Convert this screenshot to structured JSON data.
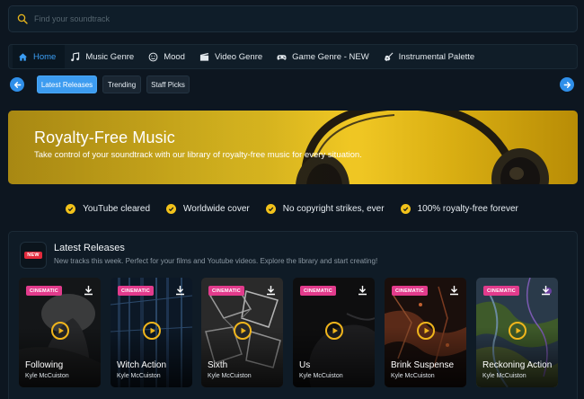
{
  "search": {
    "placeholder": "Find your soundtrack",
    "value": ""
  },
  "nav": {
    "tabs": [
      {
        "label": "Home",
        "icon": "home-icon",
        "active": true
      },
      {
        "label": "Music Genre",
        "icon": "music-note-icon",
        "active": false
      },
      {
        "label": "Mood",
        "icon": "smiley-icon",
        "active": false
      },
      {
        "label": "Video Genre",
        "icon": "film-icon",
        "active": false
      },
      {
        "label": "Game Genre - NEW",
        "icon": "gamepad-icon",
        "active": false
      },
      {
        "label": "Instrumental Palette",
        "icon": "guitar-icon",
        "active": false
      }
    ]
  },
  "subnav": {
    "pills": [
      {
        "label": "Latest Releases",
        "active": true
      },
      {
        "label": "Trending",
        "active": false
      },
      {
        "label": "Staff Picks",
        "active": false
      }
    ]
  },
  "hero": {
    "title": "Royalty-Free Music",
    "subtitle": "Take control of your soundtrack with our library of royalty-free music for every situation."
  },
  "features": [
    "YouTube cleared",
    "Worldwide cover",
    "No copyright strikes, ever",
    "100% royalty-free forever"
  ],
  "latest": {
    "badge": "NEW",
    "title": "Latest Releases",
    "subtitle": "New tracks this week. Perfect for your films and Youtube videos. Explore the library and start creating!",
    "cards": [
      {
        "tag": "CINEMATIC",
        "title": "Following",
        "artist": "Kyle McCuiston"
      },
      {
        "tag": "CINEMATIC",
        "title": "Witch Action",
        "artist": "Kyle McCuiston"
      },
      {
        "tag": "CINEMATIC",
        "title": "Sixth",
        "artist": "Kyle McCuiston"
      },
      {
        "tag": "CINEMATIC",
        "title": "Us",
        "artist": "Kyle McCuiston"
      },
      {
        "tag": "CINEMATIC",
        "title": "Brink Suspense",
        "artist": "Kyle McCuiston"
      },
      {
        "tag": "CINEMATIC",
        "title": "Reckoning Action",
        "artist": "Kyle McCuiston"
      }
    ]
  },
  "colors": {
    "accent_blue": "#3d9cf0",
    "accent_yellow": "#f2c21a",
    "tag_pink": "#e23b8c",
    "new_red": "#e22a3c",
    "background": "#0d1620"
  }
}
